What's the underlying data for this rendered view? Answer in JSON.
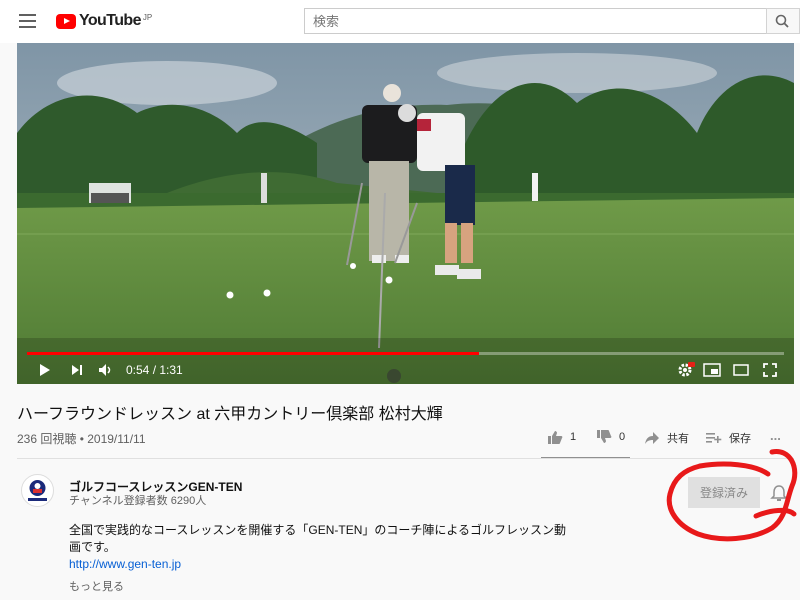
{
  "masthead": {
    "logo_text": "YouTube",
    "region": "JP",
    "search_placeholder": "検索"
  },
  "player": {
    "time_current": "0:54",
    "time_separator": " / ",
    "time_total": "1:31",
    "progress_fraction": 0.597
  },
  "video": {
    "title": "ハーフラウンドレッスン at 六甲カントリー倶楽部 松村大輝",
    "views_date": "236 回視聴 • 2019/11/11",
    "likes": "1",
    "dislikes": "0",
    "share_label": "共有",
    "save_label": "保存",
    "more_label": "..."
  },
  "channel": {
    "name": "ゴルフコースレッスンGEN-TEN",
    "subscribers": "チャンネル登録者数 6290人",
    "avatar_text": "GEN-TEN",
    "subscribed_label": "登録済み"
  },
  "description": {
    "text": "全国で実践的なコースレッスンを開催する「GEN-TEN」のコーチ陣によるゴルフレッスン動画です。",
    "link": "http://www.gen-ten.jp",
    "show_more": "もっと見る"
  },
  "colors": {
    "brand_red": "#ff0000",
    "link_blue": "#065fd4",
    "annotation_red": "#e8191a"
  },
  "icons": [
    "menu-icon",
    "youtube-logo-icon",
    "search-icon",
    "play-icon",
    "next-icon",
    "volume-icon",
    "settings-icon",
    "hd-badge-icon",
    "miniplayer-icon",
    "theater-icon",
    "fullscreen-icon",
    "like-icon",
    "dislike-icon",
    "share-icon",
    "add-to-playlist-icon",
    "bell-icon"
  ]
}
